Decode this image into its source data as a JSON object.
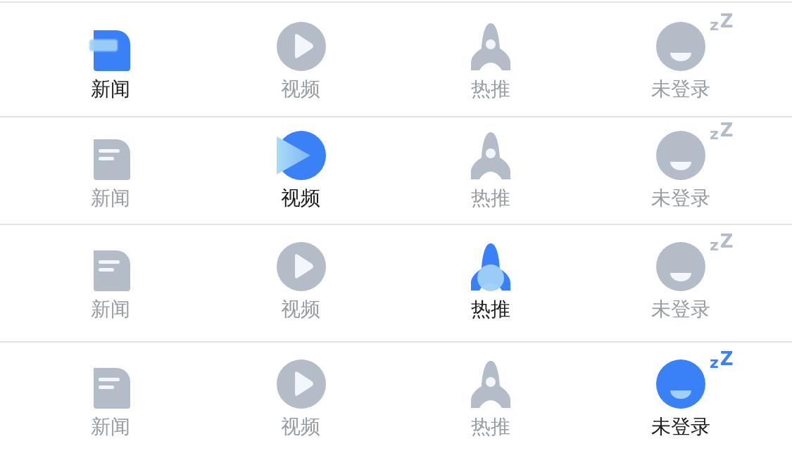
{
  "tab_bars": [
    {
      "tabs": [
        {
          "kind": "news",
          "label": "新闻",
          "selected": true
        },
        {
          "kind": "video",
          "label": "视频",
          "selected": false
        },
        {
          "kind": "hot",
          "label": "热推",
          "selected": false
        },
        {
          "kind": "profile",
          "label": "未登录",
          "selected": false,
          "sleep_marks": [
            "z",
            "Z"
          ]
        }
      ]
    },
    {
      "tabs": [
        {
          "kind": "news",
          "label": "新闻",
          "selected": false
        },
        {
          "kind": "video",
          "label": "视频",
          "selected": true
        },
        {
          "kind": "hot",
          "label": "热推",
          "selected": false
        },
        {
          "kind": "profile",
          "label": "未登录",
          "selected": false,
          "sleep_marks": [
            "z",
            "Z"
          ]
        }
      ]
    },
    {
      "tabs": [
        {
          "kind": "news",
          "label": "新闻",
          "selected": false
        },
        {
          "kind": "video",
          "label": "视频",
          "selected": false
        },
        {
          "kind": "hot",
          "label": "热推",
          "selected": true
        },
        {
          "kind": "profile",
          "label": "未登录",
          "selected": false,
          "sleep_marks": [
            "z",
            "Z"
          ]
        }
      ]
    },
    {
      "tabs": [
        {
          "kind": "news",
          "label": "新闻",
          "selected": false
        },
        {
          "kind": "video",
          "label": "视频",
          "selected": false
        },
        {
          "kind": "hot",
          "label": "热推",
          "selected": false
        },
        {
          "kind": "profile",
          "label": "未登录",
          "selected": true,
          "sleep_marks": [
            "z",
            "Z"
          ]
        }
      ]
    }
  ]
}
